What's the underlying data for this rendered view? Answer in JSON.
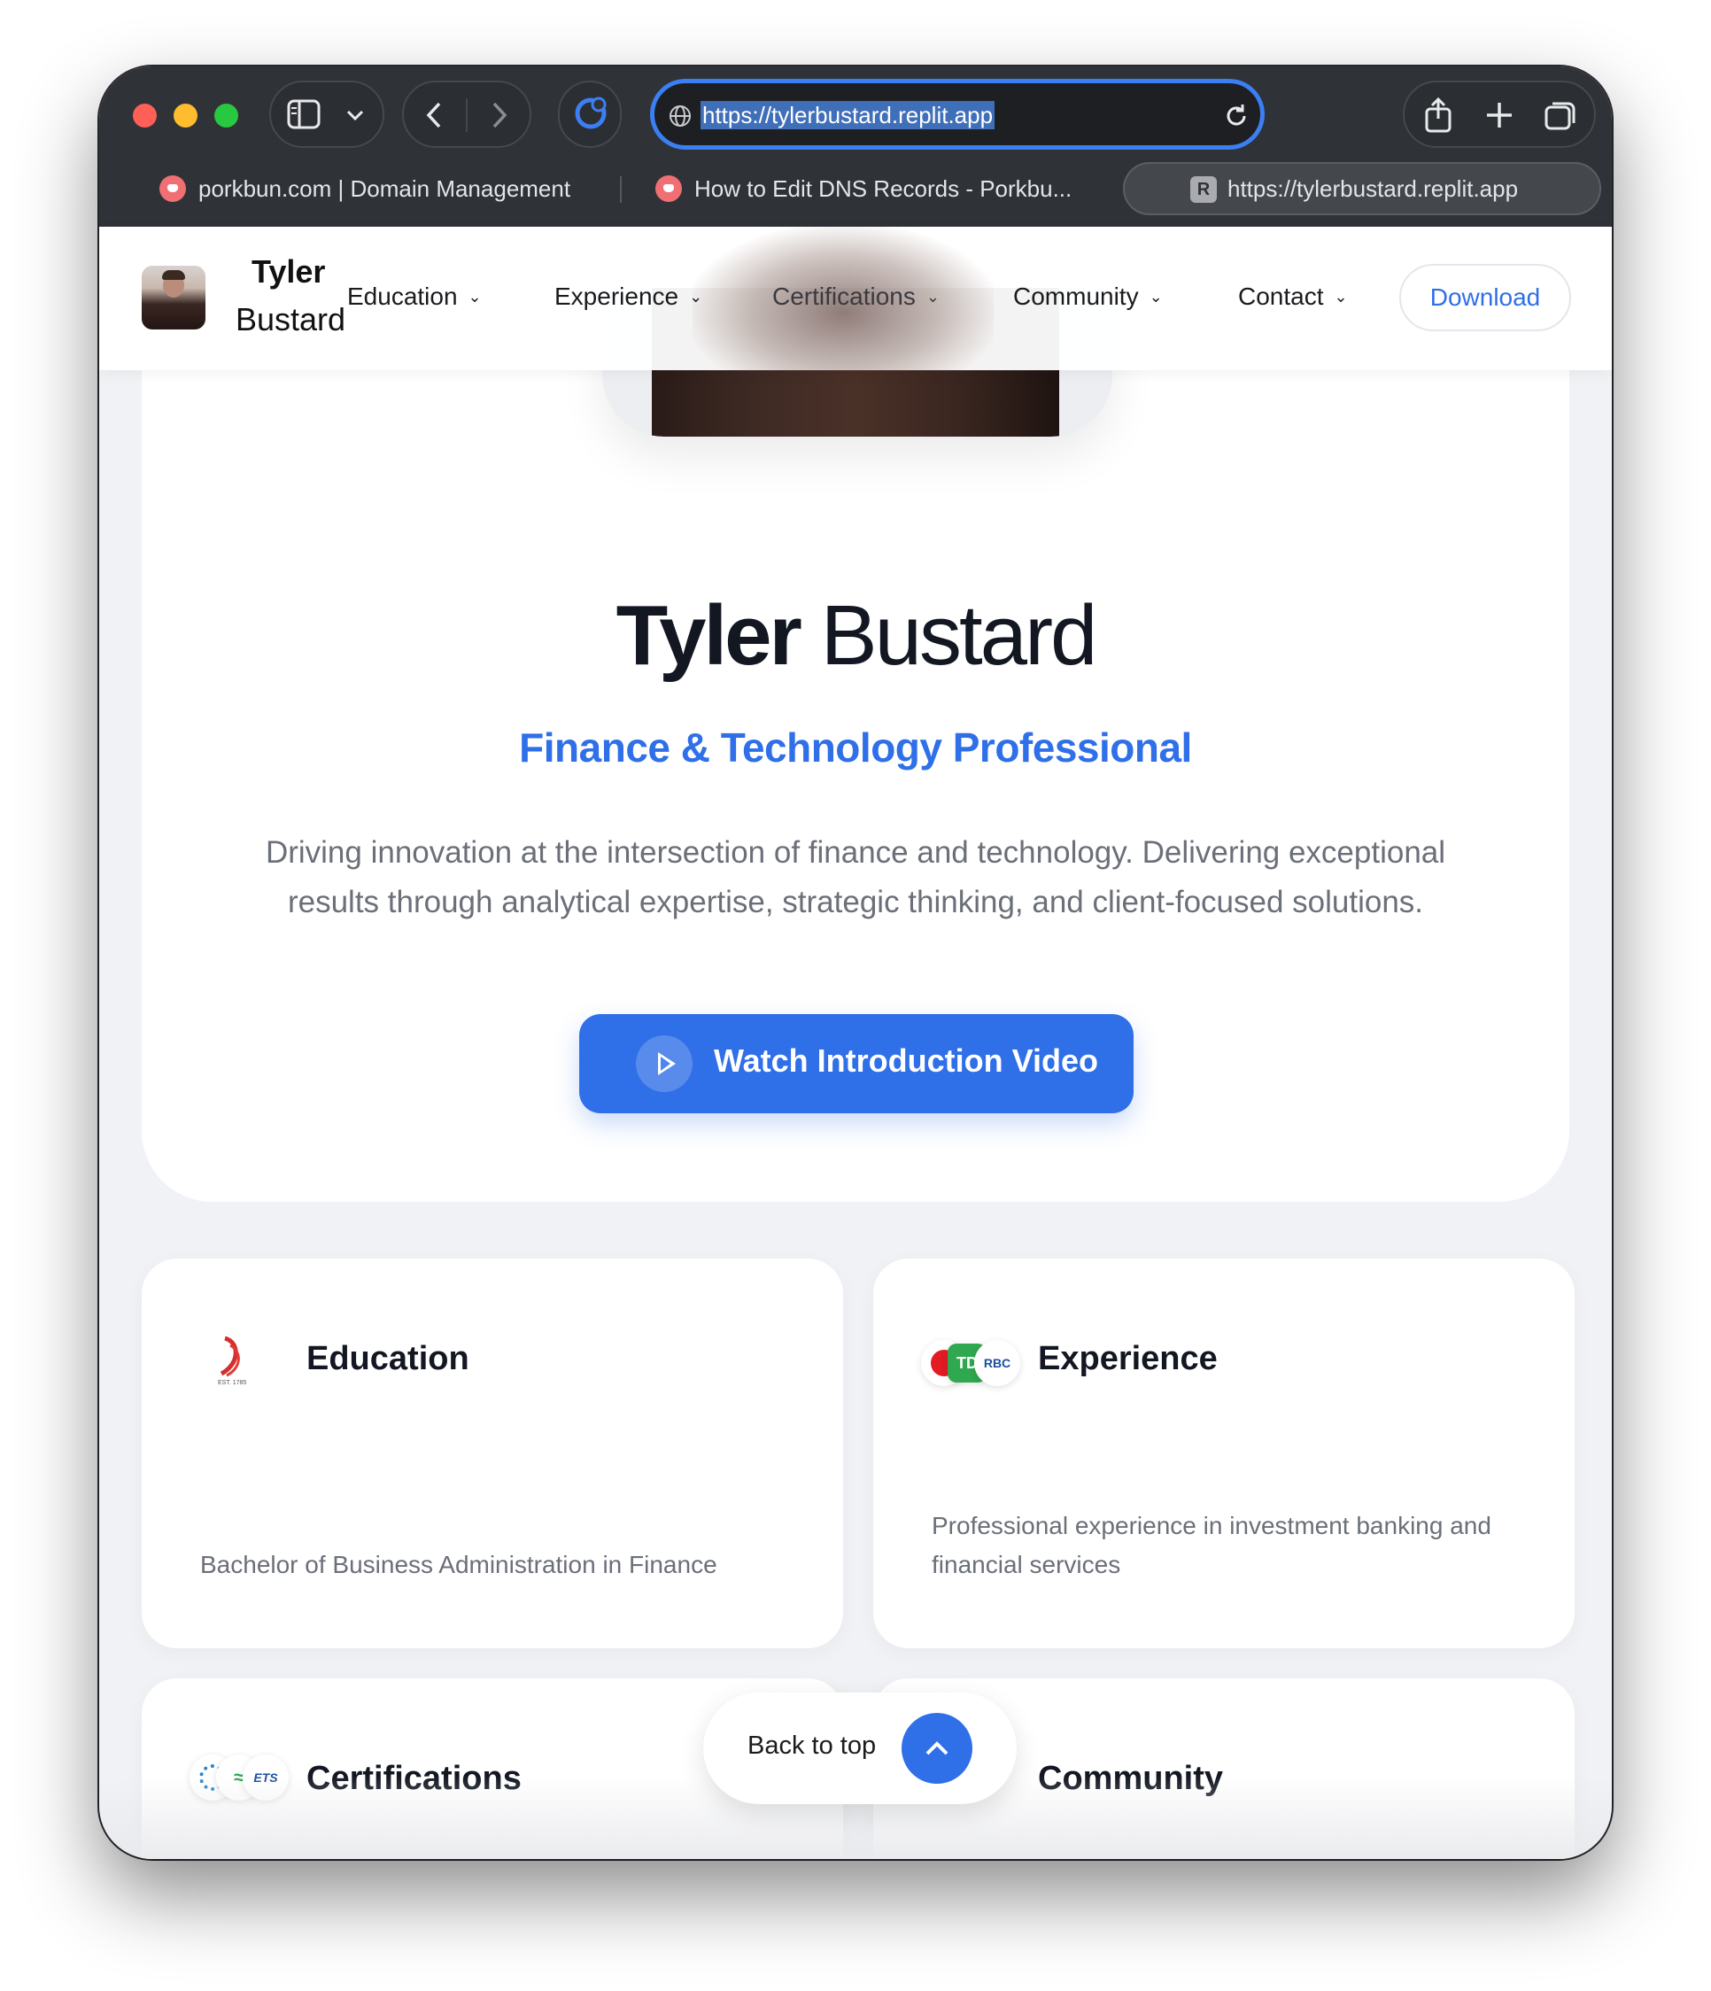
{
  "browser": {
    "url": "https://tylerbustard.replit.app",
    "tabs": [
      {
        "title": "porkbun.com | Domain Management",
        "favicon": "porkbun-icon"
      },
      {
        "title": "How to Edit DNS Records - Porkbu...",
        "favicon": "porkbun-icon"
      },
      {
        "title": "https://tylerbustard.replit.app",
        "favicon": "R",
        "active": true
      }
    ]
  },
  "nav": {
    "brand_first": "Tyler",
    "brand_last": "Bustard",
    "items": [
      {
        "label": "Education"
      },
      {
        "label": "Experience"
      },
      {
        "label": "Certifications"
      },
      {
        "label": "Community"
      },
      {
        "label": "Contact"
      }
    ],
    "download_label": "Download"
  },
  "hero": {
    "name_first": "Tyler",
    "name_last": "Bustard",
    "title": "Finance & Technology Professional",
    "description": "Driving innovation at the intersection of finance and technology. Delivering exceptional results through analytical expertise, strategic thinking, and client-focused solutions.",
    "video_button": "Watch Introduction Video"
  },
  "cards": {
    "education": {
      "title": "Education",
      "description": "Bachelor of Business Administration in Finance",
      "logo_text": "EST. 1785"
    },
    "experience": {
      "title": "Experience",
      "description": "Professional experience in investment banking and financial services",
      "logos": [
        "TD",
        "RBC"
      ]
    },
    "certifications": {
      "title": "Certifications",
      "logos": [
        "ETS"
      ]
    },
    "community": {
      "title": "Community"
    }
  },
  "back_to_top": {
    "label": "Back to top"
  },
  "colors": {
    "accent": "#2f6fe8",
    "url_focus": "#3b7ff2",
    "chrome": "#2f3237"
  }
}
